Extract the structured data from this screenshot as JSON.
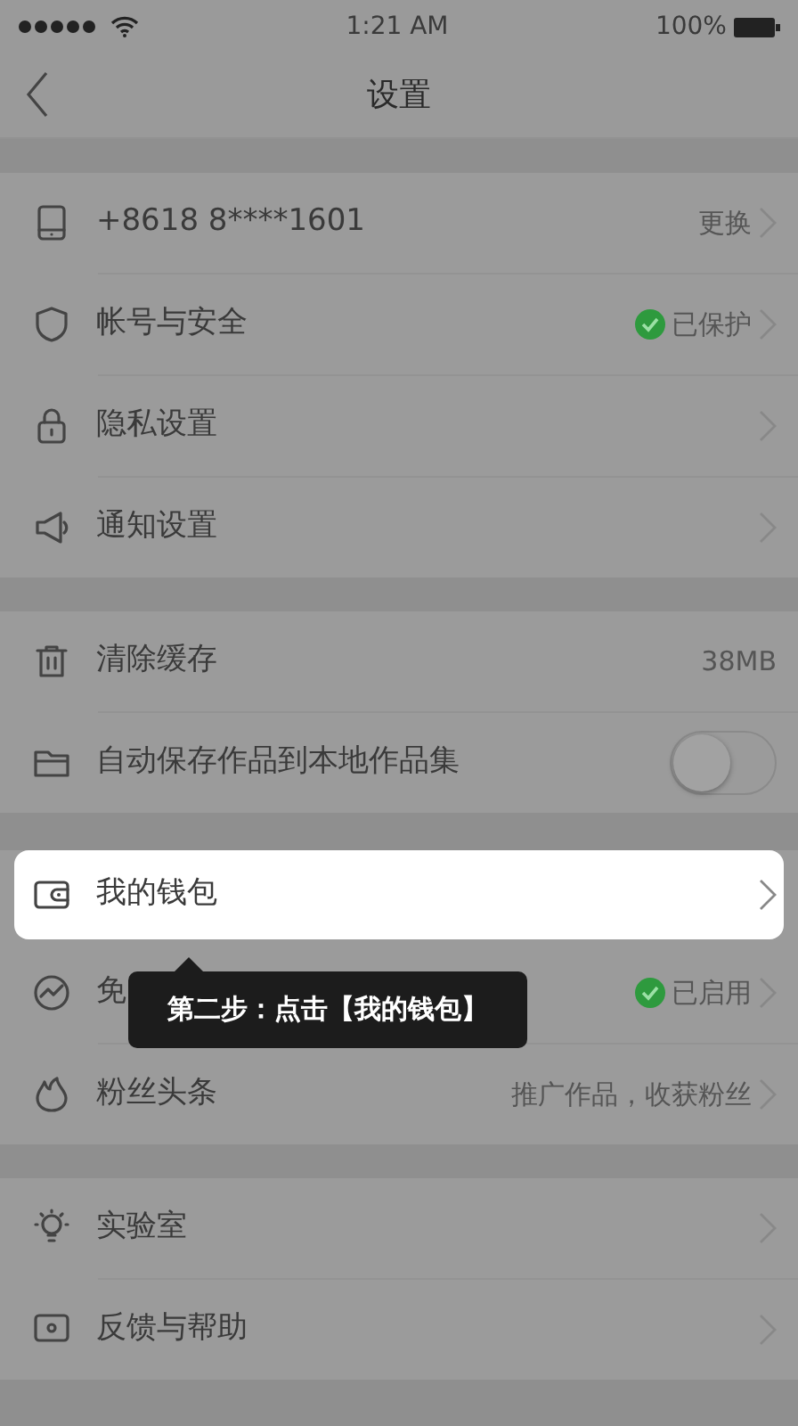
{
  "status_bar": {
    "time": "1:21 AM",
    "battery": "100%"
  },
  "nav": {
    "title": "设置"
  },
  "sections": [
    {
      "items": [
        {
          "kind": "link",
          "label": "+8618 8****1601",
          "value": "更换"
        },
        {
          "kind": "link",
          "label": "帐号与安全",
          "value": "已保护",
          "verified": true
        },
        {
          "kind": "link",
          "label": "隐私设置"
        },
        {
          "kind": "link",
          "label": "通知设置"
        }
      ]
    },
    {
      "items": [
        {
          "kind": "info",
          "label": "清除缓存",
          "value": "38MB"
        },
        {
          "kind": "toggle",
          "label": "自动保存作品到本地作品集",
          "on": false
        }
      ]
    },
    {
      "items": [
        {
          "kind": "link",
          "label": "我的钱包",
          "highlighted": true
        },
        {
          "kind": "link",
          "label": "免",
          "value": "已启用",
          "verified": true
        },
        {
          "kind": "link",
          "label": "粉丝头条",
          "value": "推广作品，收获粉丝"
        }
      ]
    },
    {
      "items": [
        {
          "kind": "link",
          "label": "实验室"
        },
        {
          "kind": "link",
          "label": "反馈与帮助"
        }
      ]
    }
  ],
  "tooltip": {
    "text": "第二步：点击【我的钱包】"
  }
}
